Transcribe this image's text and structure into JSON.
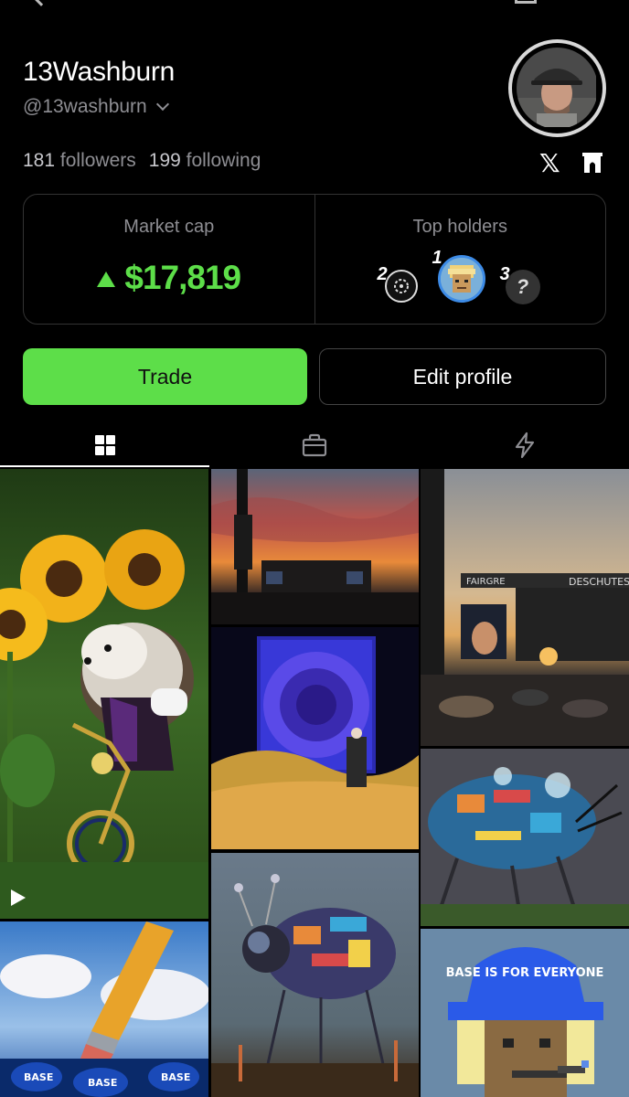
{
  "profile": {
    "name": "13Washburn",
    "handle": "@13washburn",
    "followers_count": "181",
    "followers_label": "followers",
    "following_count": "199",
    "following_label": "following"
  },
  "stats": {
    "market_cap_label": "Market cap",
    "market_cap_value": "$17,819",
    "top_holders_label": "Top holders",
    "holders": [
      {
        "rank": "1"
      },
      {
        "rank": "2"
      },
      {
        "rank": "3",
        "avatar_text": "?"
      }
    ]
  },
  "actions": {
    "trade_label": "Trade",
    "edit_profile_label": "Edit profile"
  },
  "tabs": [
    {
      "icon": "grid-icon",
      "active": true
    },
    {
      "icon": "bag-icon",
      "active": false
    },
    {
      "icon": "lightning-icon",
      "active": false
    }
  ],
  "posts": {
    "festival_banner_left": "FAIRGRE",
    "festival_banner_right": "DESCHUTES",
    "pixel_art_text": "BASE IS FOR EVERYONE",
    "base_ball_text": "BASE"
  },
  "colors": {
    "accent_green": "#5dde49",
    "background": "#000000",
    "muted_text": "#8e8e93"
  }
}
